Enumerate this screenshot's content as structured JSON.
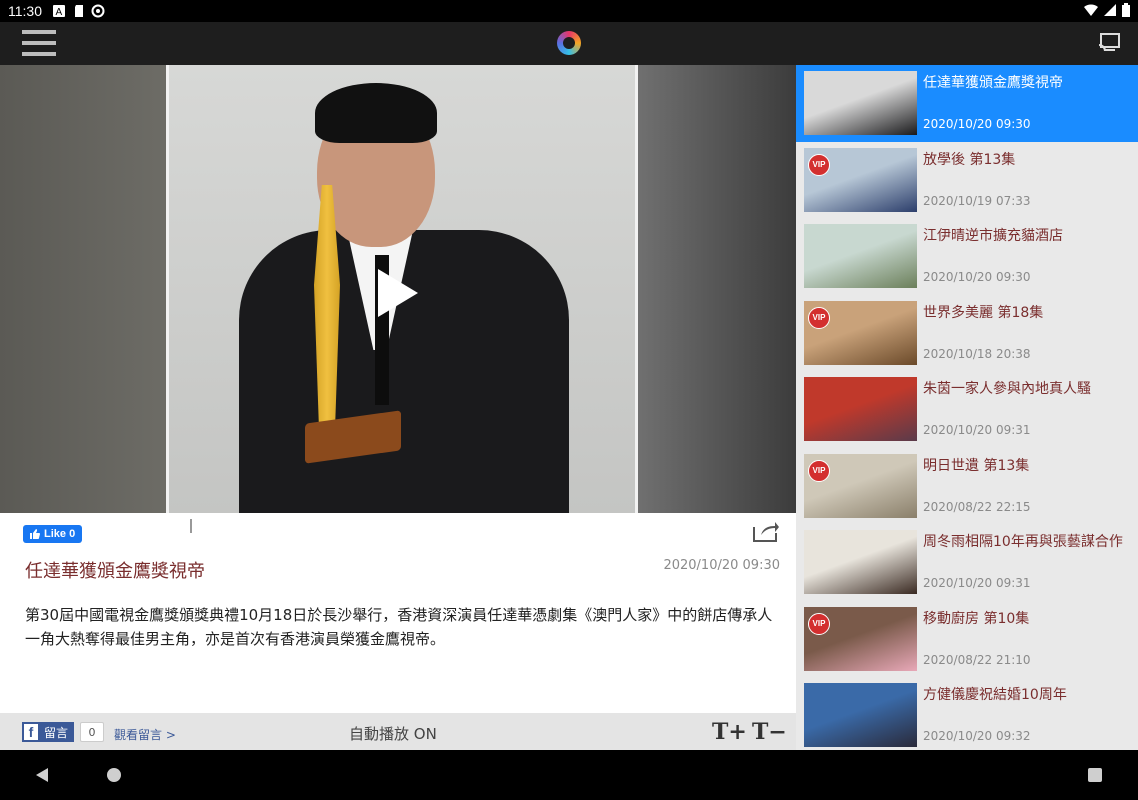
{
  "status_bar": {
    "time": "11:30"
  },
  "app_bar": {
    "menu_icon": "hamburger-menu-icon",
    "logo_icon": "app-logo-icon",
    "cast_icon": "cast-icon"
  },
  "player": {
    "play_icon": "play-icon"
  },
  "article": {
    "like_label": "Like 0",
    "title": "任達華獲頒金鷹獎視帝",
    "date": "2020/10/20 09:30",
    "body": "第30屆中國電視金鷹獎頒獎典禮10月18日於長沙舉行，香港資深演員任達華憑劇集《澳門人家》中的餅店傳承人一角大熱奪得最佳男主角，亦是首次有香港演員榮獲金鷹視帝。"
  },
  "toolbar": {
    "comment_label": "留言",
    "comment_count": "0",
    "view_comments": "觀看留言 >",
    "autoplay": "自動播放 ON",
    "font_increase": "T+",
    "font_decrease": "T−"
  },
  "playlist": [
    {
      "title": "任達華獲頒金鷹獎視帝",
      "date": "2020/10/20 09:30",
      "vip": false,
      "active": true,
      "thumb": [
        "#d9d9d9",
        "#1a1a1c"
      ]
    },
    {
      "title": "放學後 第13集",
      "date": "2020/10/19 07:33",
      "vip": true,
      "active": false,
      "thumb": [
        "#b7c7d6",
        "#2c3e6b"
      ]
    },
    {
      "title": "江伊晴逆市擴充貓酒店",
      "date": "2020/10/20 09:30",
      "vip": false,
      "active": false,
      "thumb": [
        "#c8d8d0",
        "#6b7f5a"
      ]
    },
    {
      "title": "世界多美麗 第18集",
      "date": "2020/10/18 20:38",
      "vip": true,
      "active": false,
      "thumb": [
        "#c9a27a",
        "#6b4a2a"
      ]
    },
    {
      "title": "朱茵一家人參與內地真人騷",
      "date": "2020/10/20 09:31",
      "vip": false,
      "active": false,
      "thumb": [
        "#c0392b",
        "#5a3a4a"
      ]
    },
    {
      "title": "明日世遺 第13集",
      "date": "2020/08/22 22:15",
      "vip": true,
      "active": false,
      "thumb": [
        "#cfc8b8",
        "#8a7f6a"
      ]
    },
    {
      "title": "周冬雨相隔10年再與張藝謀合作",
      "date": "2020/10/20 09:31",
      "vip": false,
      "active": false,
      "thumb": [
        "#e8e4dc",
        "#3a2a22"
      ]
    },
    {
      "title": "移動廚房 第10集",
      "date": "2020/08/22 21:10",
      "vip": true,
      "active": false,
      "thumb": [
        "#7a5a4a",
        "#e8a8b8"
      ]
    },
    {
      "title": "方健儀慶祝結婚10周年",
      "date": "2020/10/20 09:32",
      "vip": false,
      "active": false,
      "thumb": [
        "#3a6aa8",
        "#2a2a3a"
      ]
    }
  ],
  "vip_label": "VIP",
  "colors": {
    "accent": "#1a8cff",
    "title": "#7a2e2e",
    "facebook": "#3b5998"
  }
}
